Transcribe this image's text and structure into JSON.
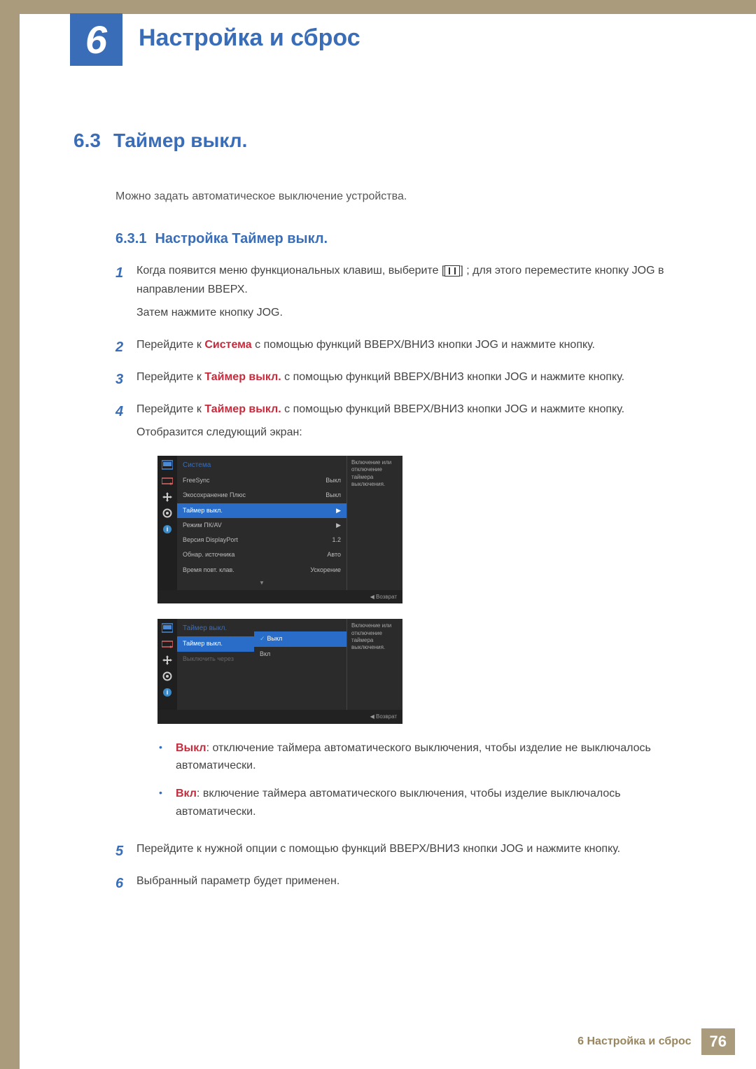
{
  "chapter": {
    "number": "6",
    "title": "Настройка и сброс"
  },
  "section": {
    "number": "6.3",
    "title": "Таймер выкл."
  },
  "intro": "Можно задать автоматическое выключение устройства.",
  "subsection": {
    "number": "6.3.1",
    "title": "Настройка Таймер выкл."
  },
  "steps": {
    "s1": {
      "num": "1",
      "p1a": "Когда появится меню функциональных клавиш, выберите [",
      "p1b": "] ; для этого переместите кнопку JOG в направлении ВВЕРХ.",
      "p2": "Затем нажмите кнопку JOG."
    },
    "s2": {
      "num": "2",
      "pre": "Перейдите к ",
      "hl": "Система",
      "post": " с помощью функций ВВЕРХ/ВНИЗ кнопки JOG и нажмите кнопку."
    },
    "s3": {
      "num": "3",
      "pre": "Перейдите к ",
      "hl": "Таймер выкл.",
      "post": " с помощью функций ВВЕРХ/ВНИЗ кнопки JOG и нажмите кнопку."
    },
    "s4": {
      "num": "4",
      "pre": "Перейдите к ",
      "hl": "Таймер выкл.",
      "post": " с помощью функций ВВЕРХ/ВНИЗ кнопки JOG и нажмите кнопку.",
      "p2": "Отобразится следующий экран:"
    },
    "s5": {
      "num": "5",
      "text": "Перейдите к нужной опции с помощью функций ВВЕРХ/ВНИЗ кнопки JOG и нажмите кнопку."
    },
    "s6": {
      "num": "6",
      "text": "Выбранный параметр будет применен."
    }
  },
  "bullets": {
    "b1": {
      "hl": "Выкл",
      "text": ": отключение таймера автоматического выключения, чтобы изделие не выключалось автоматически."
    },
    "b2": {
      "hl": "Вкл",
      "text": ": включение таймера автоматического выключения, чтобы изделие выключалось автоматически."
    }
  },
  "osd1": {
    "title": "Система",
    "rows": [
      {
        "label": "FreeSync",
        "value": "Выкл"
      },
      {
        "label": "Экосохранение Плюс",
        "value": "Выкл"
      },
      {
        "label": "Таймер выкл.",
        "value": "▶",
        "sel": true
      },
      {
        "label": "Режим ПК/AV",
        "value": "▶"
      },
      {
        "label": "Версия DisplayPort",
        "value": "1.2"
      },
      {
        "label": "Обнар. источника",
        "value": "Авто"
      },
      {
        "label": "Время повт. клав.",
        "value": "Ускорение"
      }
    ],
    "desc": "Включение или отключение таймера выключения.",
    "back": "◀ Возврат"
  },
  "osd2": {
    "title": "Таймер выкл.",
    "col1": [
      {
        "label": "Таймер выкл.",
        "sel": true
      },
      {
        "label": "Выключить через",
        "dim": true
      }
    ],
    "col2": [
      {
        "label": "Выкл",
        "sel": true,
        "check": true
      },
      {
        "label": "Вкл"
      }
    ],
    "desc": "Включение или отключение таймера выключения.",
    "back": "◀ Возврат"
  },
  "footer": {
    "label": "6 Настройка и сброс",
    "page": "76"
  }
}
